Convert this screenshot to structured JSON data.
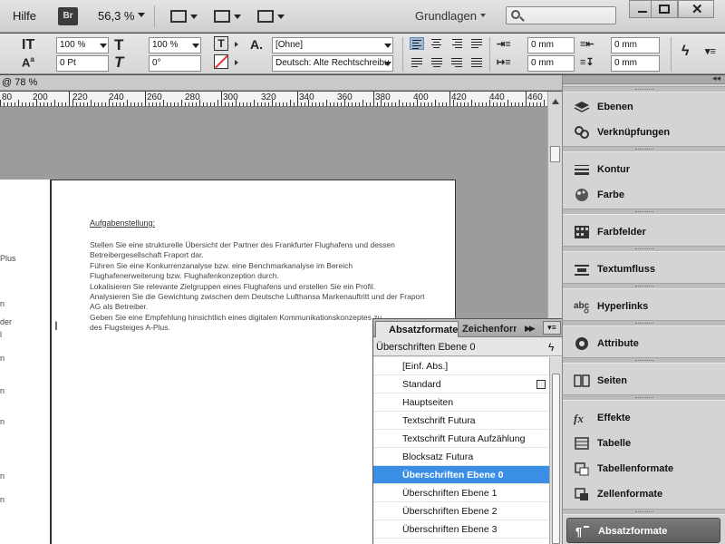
{
  "menubar": {
    "hilfe": "Hilfe",
    "br": "Br",
    "zoom": "56,3 %",
    "workspace": "Grundlagen",
    "search_placeholder": ""
  },
  "control": {
    "font_size": "100 %",
    "font_size_2": "100 %",
    "baseline": "0 Pt",
    "skew": "0°",
    "char_style": "[Ohne]",
    "language": "Deutsch: Alte Rechtschreibu",
    "indent_left": "0 mm",
    "indent_right": "0 mm",
    "space_before": "0 mm",
    "space_after": "0 mm"
  },
  "document": {
    "tab_label": "@ 78 %",
    "ruler_labels": [
      "80",
      "200",
      "220",
      "240",
      "260",
      "280",
      "300",
      "320",
      "340",
      "360",
      "380",
      "400",
      "420",
      "440",
      "460"
    ],
    "title": "Aufgabenstellung:",
    "body_lines": [
      "Stellen Sie eine strukturelle Übersicht der Partner des Frankfurter Flughafens und dessen",
      "Betreibergesellschaft Fraport dar.",
      "Führen Sie eine Konkurrenzanalyse bzw. eine Benchmarkanalyse im Bereich",
      "Flughafenerweiterung bzw. Flughafenkonzeption durch.",
      "Lokalisieren Sie relevante Zielgruppen eines Flughafens und erstellen Sie ein Profil.",
      "Analysieren Sie die Gewichtung zwischen dem Deutsche Lufthansa Markenauftritt und der Fraport",
      "AG als Betreiber.",
      "Geben Sie eine Empfehlung hinsichtlich eines digitalen Kommunikationskonzeptes zu",
      "des Flugsteiges A-Plus."
    ],
    "left_fragments": [
      "Plus",
      "n",
      "der",
      "l",
      "n",
      "n",
      "n",
      "n",
      "n"
    ]
  },
  "paragraph_panel": {
    "tab_active": "Absatzformate",
    "tab_inactive": "Zeichenformate",
    "current_style": "Überschriften Ebene 0",
    "styles": [
      "[Einf. Abs.]",
      "Standard",
      "Hauptseiten",
      "Textschrift Futura",
      "Textschrift Futura Aufzählung",
      "Blocksatz Futura",
      "Überschriften Ebene 0",
      "Überschriften Ebene 1",
      "Überschriften Ebene 2",
      "Überschriften Ebene 3"
    ],
    "selected_index": 6
  },
  "dock": {
    "items": [
      {
        "label": "Ebenen",
        "icon": "layers-icon"
      },
      {
        "label": "Verknüpfungen",
        "icon": "links-icon"
      },
      {
        "label": "Kontur",
        "icon": "stroke-icon"
      },
      {
        "label": "Farbe",
        "icon": "color-icon"
      },
      {
        "label": "Farbfelder",
        "icon": "swatches-icon"
      },
      {
        "label": "Textumfluss",
        "icon": "text-wrap-icon"
      },
      {
        "label": "Hyperlinks",
        "icon": "hyperlinks-icon"
      },
      {
        "label": "Attribute",
        "icon": "attributes-icon"
      },
      {
        "label": "Seiten",
        "icon": "pages-icon"
      },
      {
        "label": "Effekte",
        "icon": "effects-icon"
      },
      {
        "label": "Tabelle",
        "icon": "table-icon"
      },
      {
        "label": "Tabellenformate",
        "icon": "table-styles-icon"
      },
      {
        "label": "Zellenformate",
        "icon": "cell-styles-icon"
      },
      {
        "label": "Absatzformate",
        "icon": "paragraph-styles-icon"
      }
    ]
  },
  "colors": {
    "selection": "#3a8ee6",
    "pasteboard": "#9c9c9c",
    "panel_bg": "#d4d4d4"
  }
}
